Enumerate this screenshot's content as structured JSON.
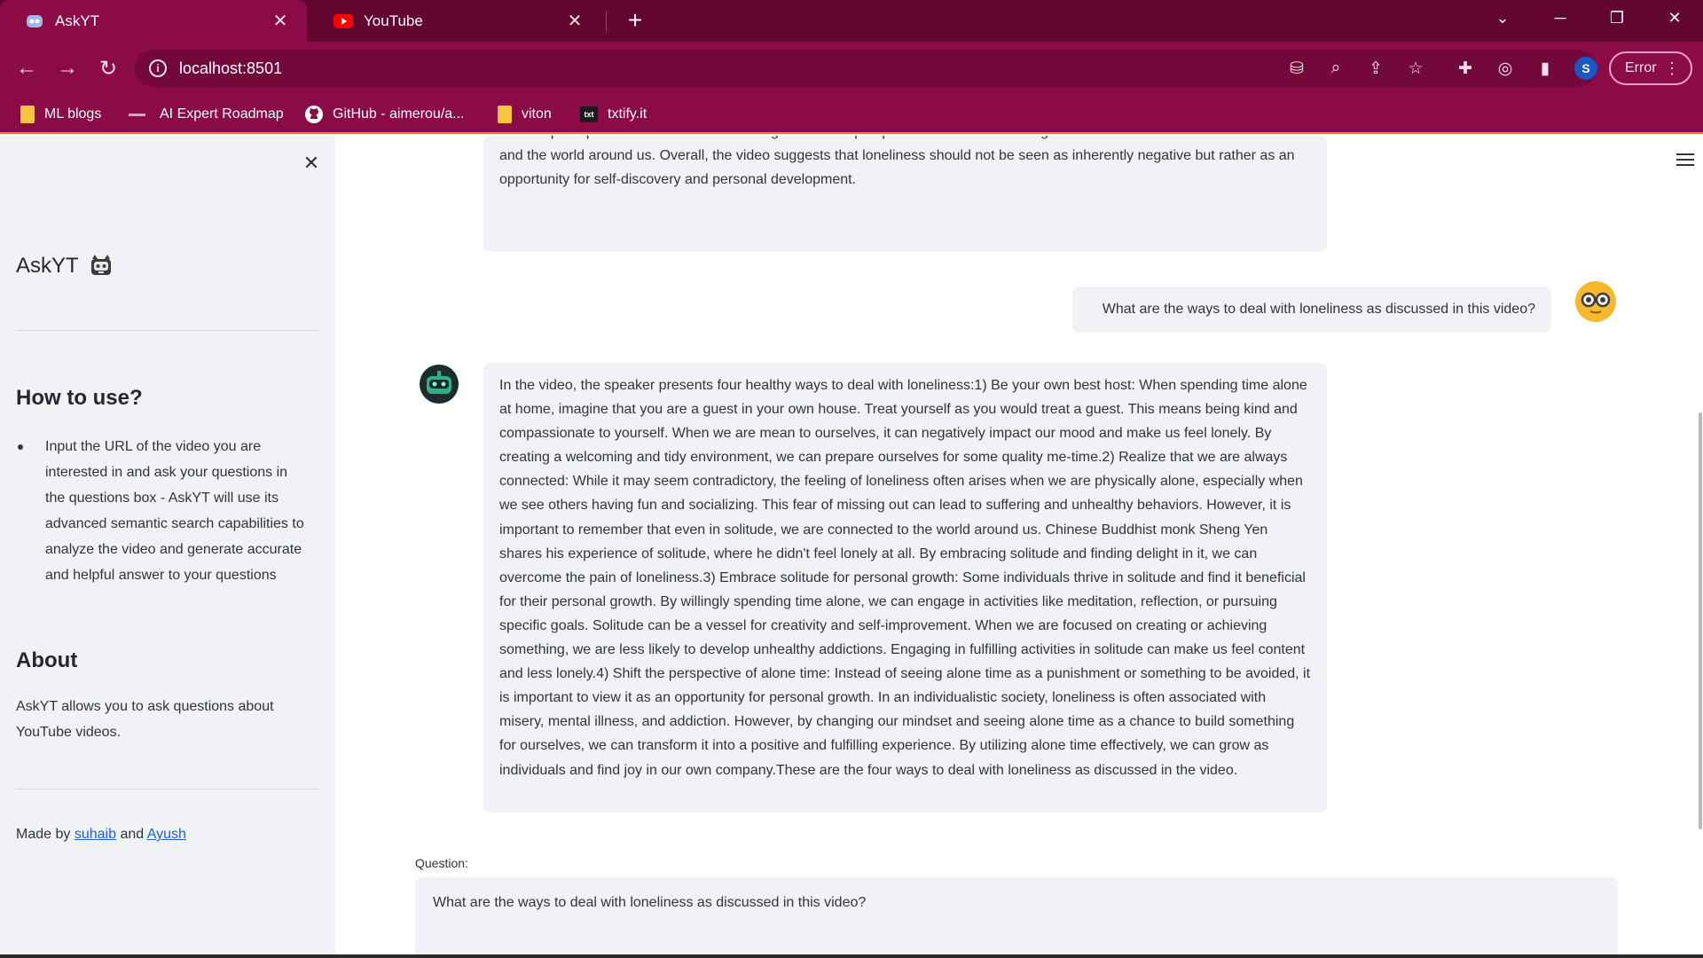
{
  "browser": {
    "tabs": [
      {
        "title": "AskYT",
        "icon": "askyt-favicon-icon",
        "active": true
      },
      {
        "title": "YouTube",
        "icon": "youtube-favicon-icon",
        "active": false
      }
    ],
    "url": "localhost:8501",
    "error_label": "Error",
    "profile_initial": "S",
    "bookmarks": [
      {
        "label": "ML blogs",
        "icon": "folder-icon"
      },
      {
        "label": "AI Expert Roadmap",
        "icon": "roadmap-icon"
      },
      {
        "label": "GitHub - aimerou/a...",
        "icon": "github-icon"
      },
      {
        "label": "viton",
        "icon": "folder-icon"
      },
      {
        "label": "txtify.it",
        "icon": "txtify-icon",
        "icon_text": "txt"
      }
    ],
    "colors": {
      "tabbar": "#62062f",
      "toolbar": "#8a0b45",
      "accent_line": "#ff7a2f"
    }
  },
  "sidebar": {
    "brand": "AskYT",
    "how_to_title": "How to use?",
    "how_to_items": [
      "Input the URL of the video you are interested in and ask your questions in the questions box - AskYT will use its advanced semantic search capabilities to analyze the video and generate accurate and helpful answer to your questions"
    ],
    "about_title": "About",
    "about_text": "AskYT allows you to ask questions about YouTube videos.",
    "made_by_prefix": "Made by",
    "made_by_and": "and",
    "author1": "suhaib",
    "author2": "Ayush"
  },
  "chat": {
    "prev_answer_tail": "and the perception of loneliness. It encourages a shift in perspective and understanding that we are all connected to each other and the world around us. Overall, the video suggests that loneliness should not be seen as inherently negative but rather as an opportunity for self-discovery and personal development.",
    "user_question": "What are the ways to deal with loneliness as discussed in this video?",
    "bot_answer": "In the video, the speaker presents four healthy ways to deal with loneliness:1) Be your own best host: When spending time alone at home, imagine that you are a guest in your own house. Treat yourself as you would treat a guest. This means being kind and compassionate to yourself. When we are mean to ourselves, it can negatively impact our mood and make us feel lonely. By creating a welcoming and tidy environment, we can prepare ourselves for some quality me-time.2) Realize that we are always connected: While it may seem contradictory, the feeling of loneliness often arises when we are physically alone, especially when we see others having fun and socializing. This fear of missing out can lead to suffering and unhealthy behaviors. However, it is important to remember that even in solitude, we are connected to the world around us. Chinese Buddhist monk Sheng Yen shares his experience of solitude, where he didn't feel lonely at all. By embracing solitude and finding delight in it, we can overcome the pain of loneliness.3) Embrace solitude for personal growth: Some individuals thrive in solitude and find it beneficial for their personal growth. By willingly spending time alone, we can engage in activities like meditation, reflection, or pursuing specific goals. Solitude can be a vessel for creativity and self-improvement. When we are focused on creating or achieving something, we are less likely to develop unhealthy addictions. Engaging in fulfilling activities in solitude can make us feel content and less lonely.4) Shift the perspective of alone time: Instead of seeing alone time as a punishment or something to be avoided, it is important to view it as an opportunity for personal growth. In an individualistic society, loneliness is often associated with misery, mental illness, and addiction. However, by changing our mindset and seeing alone time as a chance to build something for ourselves, we can transform it into a positive and fulfilling experience. By utilizing alone time effectively, we can grow as individuals and find joy in our own company.These are the four ways to deal with loneliness as discussed in the video.",
    "question_label": "Question:",
    "question_value": "What are the ways to deal with loneliness as discussed in this video?"
  }
}
